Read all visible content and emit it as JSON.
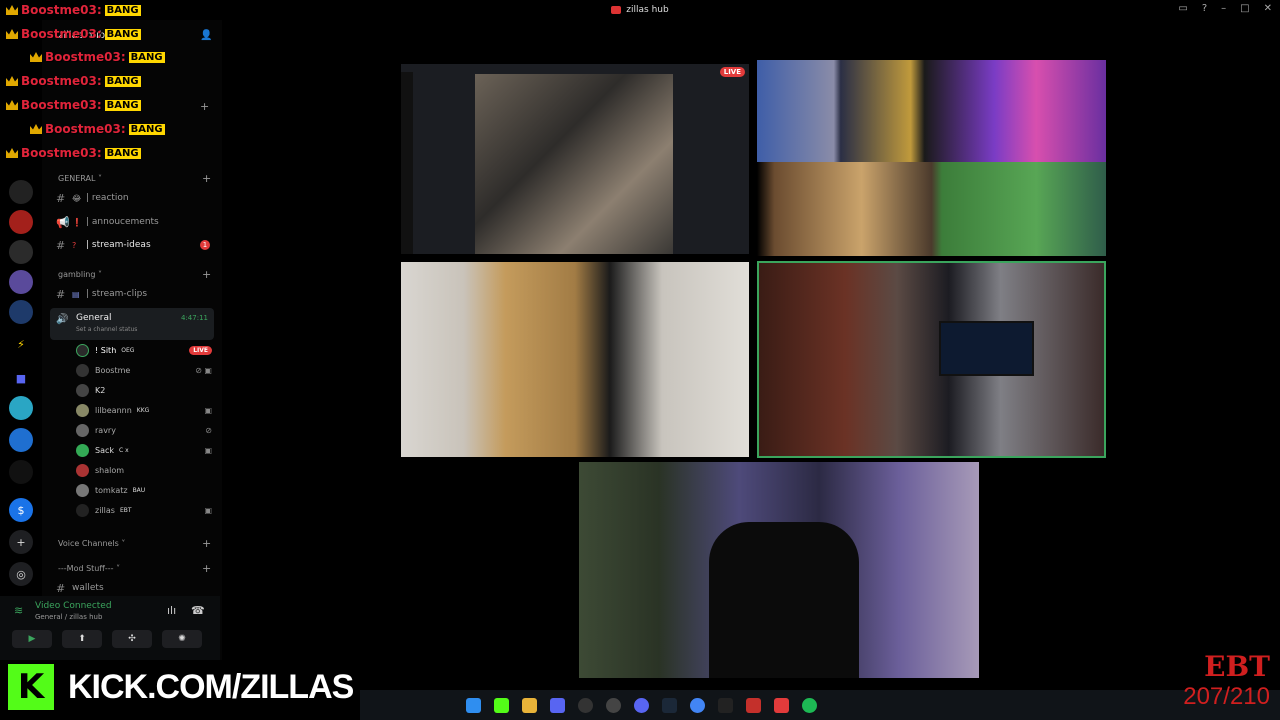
{
  "window": {
    "title": "zillas hub"
  },
  "server": {
    "name": "zillas hub"
  },
  "chat_overlay": {
    "lines": [
      {
        "user": "Boostme03:",
        "msg": "BANG"
      },
      {
        "user": "Boostme03:",
        "msg": "BANG"
      },
      {
        "user": "Boostme03:",
        "msg": "BANG"
      },
      {
        "user": "Boostme03:",
        "msg": "BANG"
      },
      {
        "user": "Boostme03:",
        "msg": "BANG"
      },
      {
        "user": "Boostme03:",
        "msg": "BANG"
      },
      {
        "user": "Boostme03:",
        "msg": "BANG"
      }
    ]
  },
  "categories": {
    "general": "GENERAL",
    "gambling": "gambling",
    "voice": "Voice Channels",
    "mod": "---Mod Stuff---"
  },
  "channels": {
    "reaction": "| reaction",
    "annoucements": "| annoucements",
    "stream_ideas": "| stream-ideas",
    "stream_ideas_badge": "1",
    "stream_clips": "| stream-clips",
    "wallets": "wallets"
  },
  "voice_channel": {
    "name": "General",
    "status": "Set a channel status",
    "timer": "4:47:11"
  },
  "members": [
    {
      "name": "! Sith",
      "tag": "OEG",
      "live": "LIVE"
    },
    {
      "name": "Boostme",
      "tag": ""
    },
    {
      "name": "K2",
      "tag": ""
    },
    {
      "name": "lilbeannn",
      "tag": "KKG"
    },
    {
      "name": "ravry",
      "tag": ""
    },
    {
      "name": "Sack",
      "tag": "C x"
    },
    {
      "name": "shalom",
      "tag": ""
    },
    {
      "name": "tomkatz",
      "tag": "BAU"
    },
    {
      "name": "zillas",
      "tag": "EBT"
    }
  ],
  "user_panel": {
    "title": "Video Connected",
    "subtitle": "General / zillas hub"
  },
  "tiles": {
    "screen_live": "LIVE"
  },
  "overlay": {
    "kick_url": "KICK.COM/ZILLAS",
    "kick_logo": "K",
    "ebt_title": "EBT",
    "ebt_count": "207/210"
  },
  "colors": {
    "accent_green": "#3ba55d",
    "live_red": "#e23b3b",
    "kick_green": "#53fc18"
  }
}
